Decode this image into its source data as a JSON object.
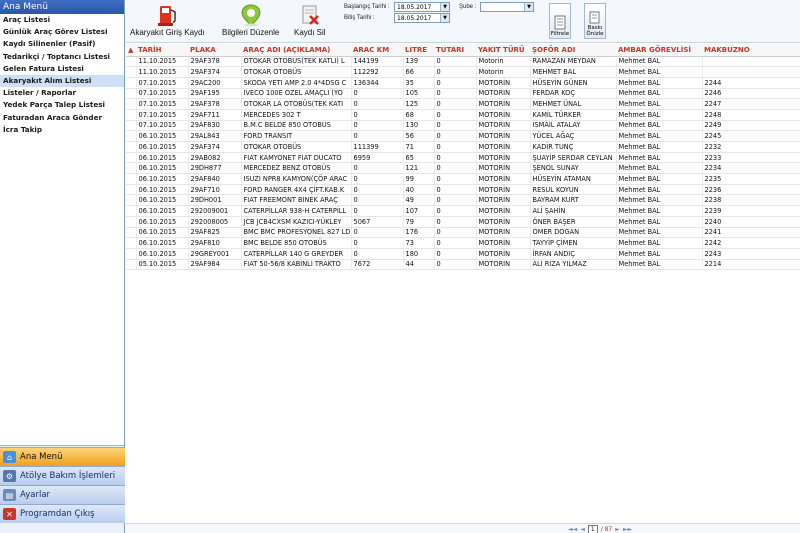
{
  "sidebar": {
    "header": "Ana Menü",
    "items": [
      {
        "label": "Araç Listesi"
      },
      {
        "label": "Günlük Araç Görev Listesi"
      },
      {
        "label": "Kaydı Silinenler (Pasif)"
      },
      {
        "label": "Tedarikçi / Toptancı Listesi"
      },
      {
        "label": "Gelen Fatura Listesi"
      },
      {
        "label": "Akaryakıt Alım Listesi"
      },
      {
        "label": "Listeler / Raporlar"
      },
      {
        "label": "Yedek Parça Talep Listesi"
      },
      {
        "label": "Faturadan Araca Gönder"
      },
      {
        "label": "İcra Takip"
      }
    ],
    "bottom": [
      {
        "label": "Ana Menü",
        "icon": "home-icon"
      },
      {
        "label": "Atölye Bakım İşlemleri",
        "icon": "wrench-icon"
      },
      {
        "label": "Ayarlar",
        "icon": "settings-icon"
      },
      {
        "label": "Programdan Çıkış",
        "icon": "exit-icon"
      }
    ]
  },
  "toolbar": {
    "add_label": "Akaryakıt Giriş Kaydı",
    "edit_label": "Bilgileri Düzenle",
    "delete_label": "Kaydı Sil",
    "start_date_label": "Başlangıç Tarihi :",
    "start_date": "18.05.2017",
    "end_date_label": "Bitiş Tarihi :",
    "end_date": "18.05.2017",
    "branch_label": "Şube :",
    "branch_value": "",
    "filter_label": "Filtrele",
    "print_label": "Baskı Önizle"
  },
  "table": {
    "columns": [
      "TARİH",
      "PLAKA",
      "ARAÇ ADI (AÇIKLAMA)",
      "ARAC KM",
      "LITRE",
      "TUTARI",
      "YAKIT TÜRÜ",
      "ŞOFÖR ADI",
      "AMBAR GÖREVLİSİ",
      "MAKBUZNO"
    ],
    "rows": [
      [
        "11.10.2015",
        "29AF378",
        "OTOKAR OTOBÜS(TEK KATLI) L",
        "144199",
        "139",
        "0",
        "Motorin",
        "RAMAZAN MEYDAN",
        "Mehmet BAL",
        ""
      ],
      [
        "11.10.2015",
        "29AF374",
        "OTOKAR OTOBÜS",
        "112292",
        "66",
        "0",
        "Motorin",
        "MEHMET BAL",
        "Mehmet BAL",
        ""
      ],
      [
        "07.10.2015",
        "29AC200",
        "SKODA YETI AMP 2.0 4*4DSG C",
        "136344",
        "35",
        "0",
        "MOTORİN",
        "HÜSEYİN GÜNEN",
        "Mehmet BAL",
        "2244"
      ],
      [
        "07.10.2015",
        "29AF195",
        "IVECO 100E ÖZEL AMAÇLI (YO",
        "0",
        "105",
        "0",
        "MOTORİN",
        "FERDAR KOÇ",
        "Mehmet BAL",
        "2246"
      ],
      [
        "07.10.2015",
        "29AF378",
        "OTOKAR LA OTOBÜS(TEK KATI",
        "0",
        "125",
        "0",
        "MOTORİN",
        "MEHMET ÜNAL",
        "Mehmet BAL",
        "2247"
      ],
      [
        "07.10.2015",
        "29AF711",
        "MERCEDES 302 T",
        "0",
        "68",
        "0",
        "MOTORİN",
        "KAMİL TÜRKER",
        "Mehmet BAL",
        "2248"
      ],
      [
        "07.10.2015",
        "29AF830",
        "B.M.C BELDE 850 OTOBÜS",
        "0",
        "130",
        "0",
        "MOTORİN",
        "İSMAİL ATALAY",
        "Mehmet BAL",
        "2249"
      ],
      [
        "06.10.2015",
        "29AL843",
        "FORD TRANSIT",
        "0",
        "56",
        "0",
        "MOTORİN",
        "YÜCEL AĞAÇ",
        "Mehmet BAL",
        "2245"
      ],
      [
        "06.10.2015",
        "29AF374",
        "OTOKAR OTOBÜS",
        "111399",
        "71",
        "0",
        "MOTORİN",
        "KADİR TUNÇ",
        "Mehmet BAL",
        "2232"
      ],
      [
        "06.10.2015",
        "29AB082",
        "FIAT KAMYONET FIAT DUCATO",
        "6959",
        "65",
        "0",
        "MOTORİN",
        "ŞUAYİP SERDAR CEYLAN",
        "Mehmet BAL",
        "2233"
      ],
      [
        "06.10.2015",
        "29DH877",
        "MERCEDEZ BENZ OTOBÜS",
        "0",
        "121",
        "0",
        "MOTORİN",
        "ŞENOL SUNAY",
        "Mehmet BAL",
        "2234"
      ],
      [
        "06.10.2015",
        "29AF840",
        "ISUZI NPR8 KAMYON(ÇÖP ARAC",
        "0",
        "99",
        "0",
        "MOTORİN",
        "HÜSEYİN ATAMAN",
        "Mehmet BAL",
        "2235"
      ],
      [
        "06.10.2015",
        "29AF710",
        "FORD RANGER 4X4 ÇİFT.KAB.K",
        "0",
        "40",
        "0",
        "MOTORİN",
        "RESUL KOYUN",
        "Mehmet BAL",
        "2236"
      ],
      [
        "06.10.2015",
        "29DH001",
        "FIAT FREEMONT BINEK ARAÇ",
        "0",
        "49",
        "0",
        "MOTORİN",
        "BAYRAM KURT",
        "Mehmet BAL",
        "2238"
      ],
      [
        "06.10.2015",
        "292009001",
        "CATERPİLLAR 938-H CATERPİLL",
        "0",
        "107",
        "0",
        "MOTORİN",
        "ALİ ŞAHİN",
        "Mehmet BAL",
        "2239"
      ],
      [
        "06.10.2015",
        "292008005",
        "JCB JCB4CXSM KAZICI-YÜKLEY",
        "5067",
        "79",
        "0",
        "MOTORİN",
        "ÖNER BAŞER",
        "Mehmet BAL",
        "2240"
      ],
      [
        "06.10.2015",
        "29AF825",
        "BMC BMC PROFESYONEL 827 LD",
        "0",
        "176",
        "0",
        "MOTORİN",
        "ÖMER DOĞAN",
        "Mehmet BAL",
        "2241"
      ],
      [
        "06.10.2015",
        "29AF810",
        "BMC BELDE 850 OTOBÜS",
        "0",
        "73",
        "0",
        "MOTORİN",
        "TAYYİP ÇİMEN",
        "Mehmet BAL",
        "2242"
      ],
      [
        "06.10.2015",
        "29GREY001",
        "CATERPİLLAR 140 G GREYDER",
        "0",
        "180",
        "0",
        "MOTORİN",
        "İRFAN ANDIÇ",
        "Mehmet BAL",
        "2243"
      ],
      [
        "05.10.2015",
        "29AF984",
        "FIAT 50-56/8 KABİNLİ TRAKTÖ",
        "7672",
        "44",
        "0",
        "MOTORİN",
        "ALİ RIZA YILMAZ",
        "Mehmet BAL",
        "2214"
      ]
    ]
  },
  "pager": {
    "current_page": "1",
    "total_pages": "/ 87"
  }
}
